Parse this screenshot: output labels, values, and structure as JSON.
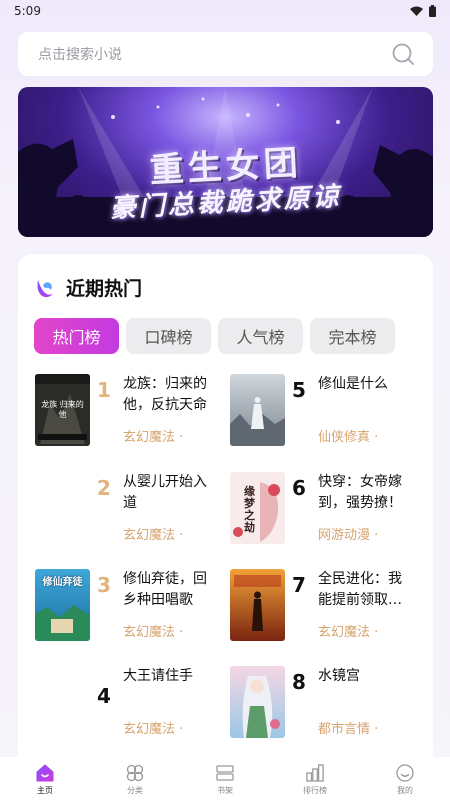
{
  "status_bar": {
    "time": "5:09"
  },
  "search": {
    "placeholder": "点击搜索小说"
  },
  "banner": {
    "title": "重生女团",
    "subtitle": "豪门总裁跪求原谅"
  },
  "section": {
    "title": "近期热门"
  },
  "tabs": [
    {
      "label": "热门榜",
      "active": true
    },
    {
      "label": "口碑榜",
      "active": false
    },
    {
      "label": "人气榜",
      "active": false
    },
    {
      "label": "完本榜",
      "active": false
    }
  ],
  "books": [
    {
      "rank": "1",
      "title": "龙族：归来的他，反抗天命",
      "genre": "玄幻魔法 ·"
    },
    {
      "rank": "2",
      "title": "从婴儿开始入道",
      "genre": "玄幻魔法 ·"
    },
    {
      "rank": "3",
      "title": "修仙弃徒，回乡种田唱歌",
      "genre": "玄幻魔法 ·"
    },
    {
      "rank": "4",
      "title": "大王请住手",
      "genre": "玄幻魔法 ·"
    },
    {
      "rank": "5",
      "title": "修仙是什么",
      "genre": "仙侠修真 ·"
    },
    {
      "rank": "6",
      "title": "快穿：女帝嫁到，强势撩！",
      "genre": "网游动漫 ·"
    },
    {
      "rank": "7",
      "title": "全民进化：我能提前领取奖励",
      "genre": "玄幻魔法 ·"
    },
    {
      "rank": "8",
      "title": "水镜宫",
      "genre": "都市言情 ·"
    }
  ],
  "covers": {
    "cover_1_text": "龙族 归来的他",
    "cover_3_text": "修仙弃徒",
    "cover_6_text": "缘梦之劫"
  },
  "tab_bar": [
    {
      "label": "主页",
      "icon": "home-icon",
      "active": true
    },
    {
      "label": "分类",
      "icon": "category-icon",
      "active": false
    },
    {
      "label": "书架",
      "icon": "bookshelf-icon",
      "active": false
    },
    {
      "label": "排行榜",
      "icon": "ranking-icon",
      "active": false
    },
    {
      "label": "我的",
      "icon": "profile-icon",
      "active": false
    }
  ],
  "colors": {
    "accent": "#d13fd6",
    "rank_top3": "#e0b47a",
    "genre": "#d6a36d"
  }
}
